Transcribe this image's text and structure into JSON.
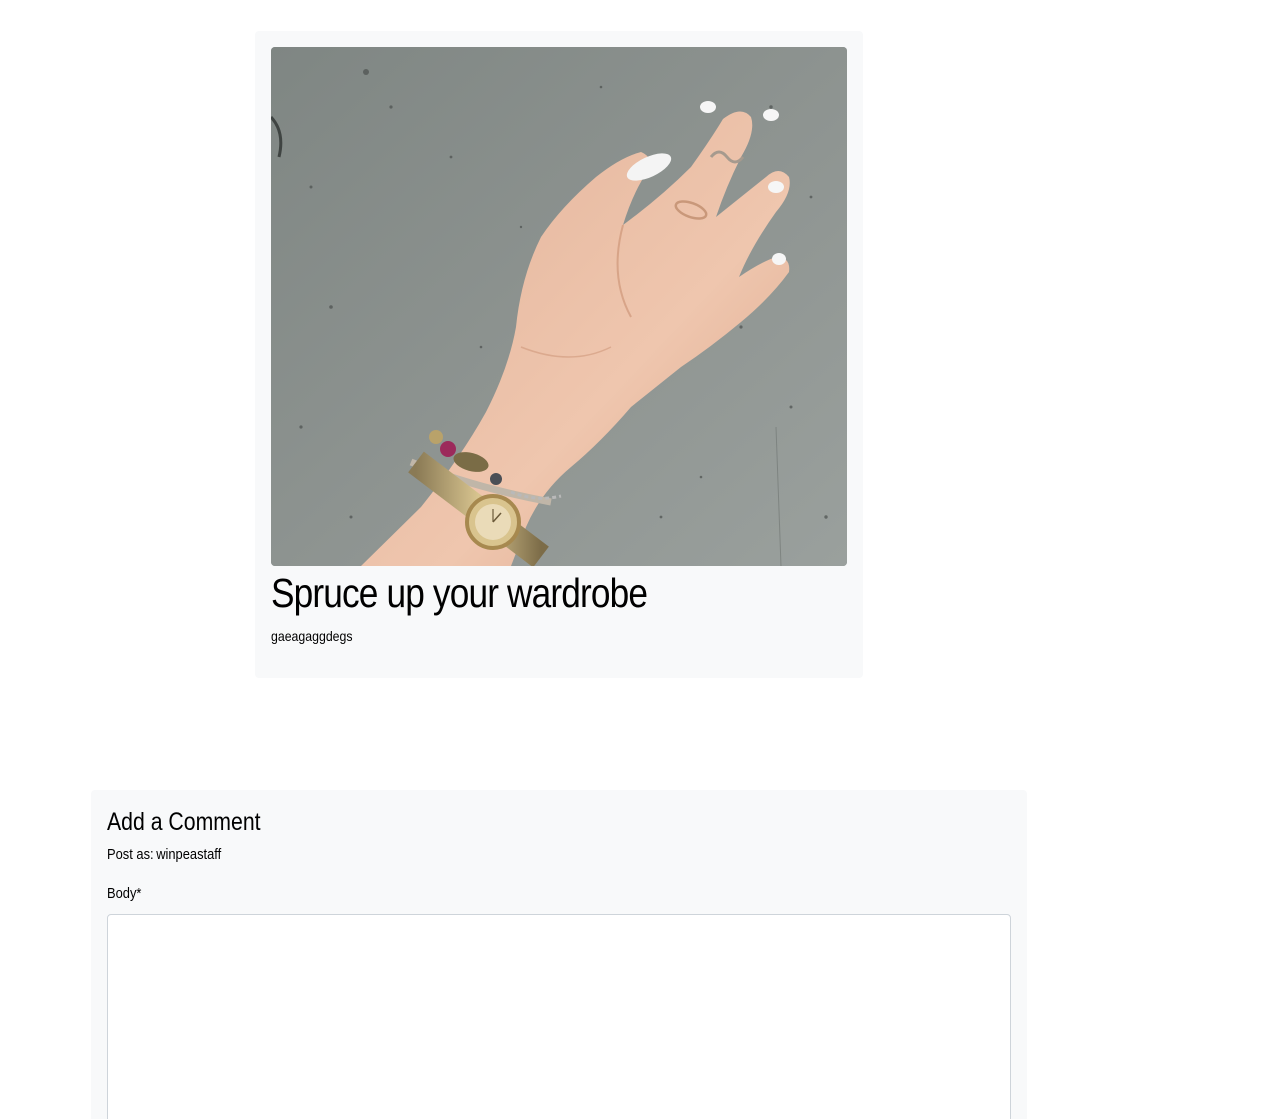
{
  "post": {
    "image_alt": "Hand wearing rings and a gold wristwatch with a beaded bracelet against a grey concrete wall",
    "title": "Spruce up your wardrobe",
    "body": "gaeagaggdegs"
  },
  "comment_form": {
    "heading": "Add a Comment",
    "post_as_label": "Post as:",
    "username": "winpeastaff",
    "body_label": "Body*",
    "body_value": "",
    "body_placeholder": ""
  },
  "colors": {
    "card_background": "#f8f9fa",
    "page_background": "#ffffff",
    "textarea_border": "#ced4da",
    "wall_grey": "#8b918e"
  }
}
